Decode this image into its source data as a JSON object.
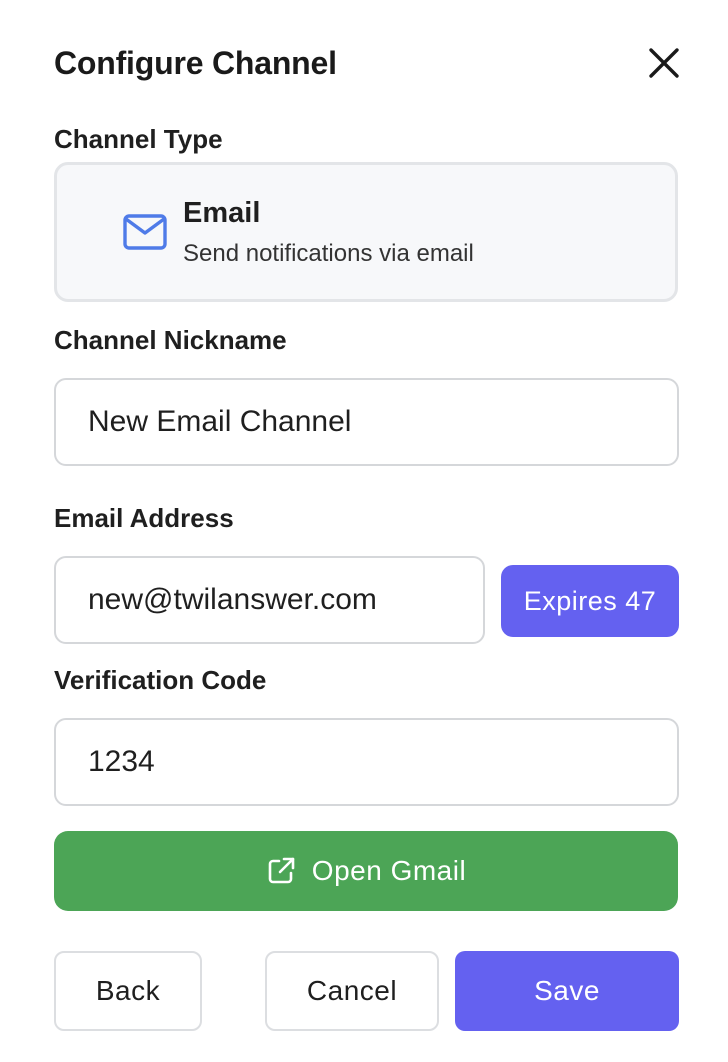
{
  "header": {
    "title": "Configure Channel",
    "close_icon": "close-icon"
  },
  "channel_type": {
    "label": "Channel Type",
    "icon": "envelope-icon",
    "name": "Email",
    "description": "Send notifications via email"
  },
  "nickname": {
    "label": "Channel Nickname",
    "value": "New Email Channel"
  },
  "email": {
    "label": "Email Address",
    "value": "new@twilanswer.com",
    "expires_badge": "Expires 47"
  },
  "verification": {
    "label": "Verification Code",
    "value": "1234"
  },
  "open_gmail": {
    "label": "Open Gmail",
    "icon": "external-link-icon"
  },
  "footer": {
    "back_label": "Back",
    "cancel_label": "Cancel",
    "save_label": "Save"
  },
  "colors": {
    "primary": "#6461f0",
    "success": "#4ca556",
    "icon_blue": "#4f7be8"
  }
}
